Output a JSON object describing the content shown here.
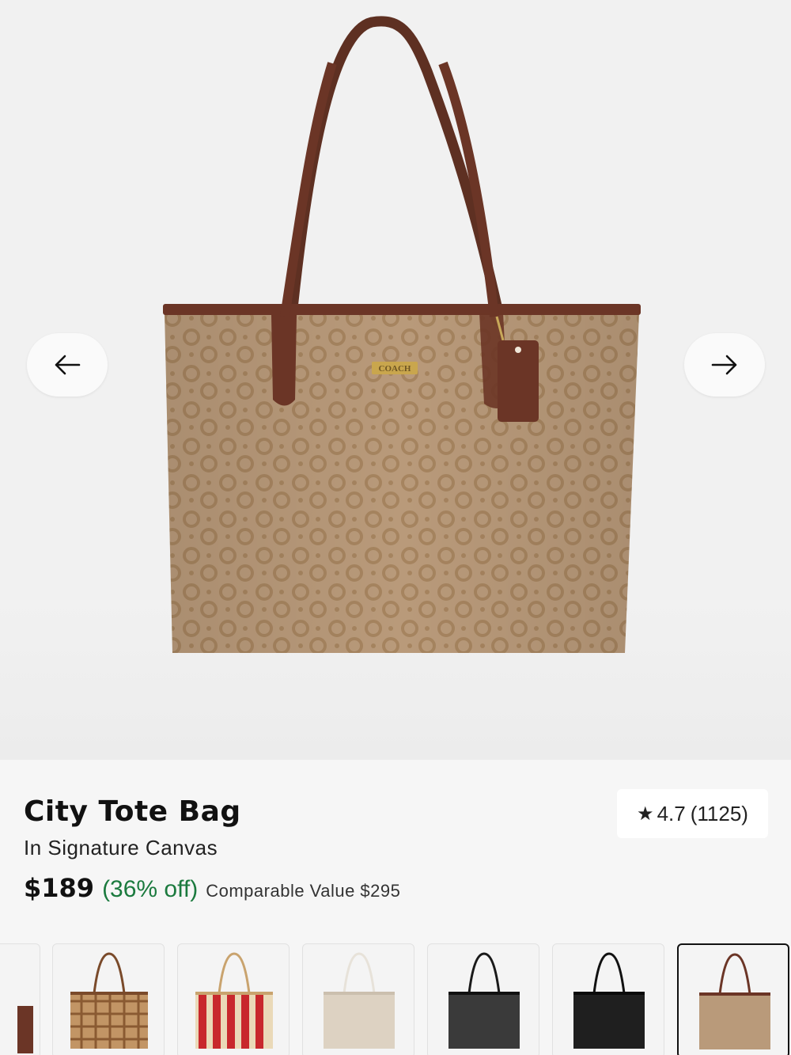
{
  "gallery": {
    "prev_label": "previous image",
    "next_label": "next image",
    "bag_logo_text": "COACH"
  },
  "product": {
    "title": "City Tote Bag",
    "subtitle": "In Signature Canvas",
    "price": "$189",
    "discount": "(36% off)",
    "comparable": "Comparable Value $295"
  },
  "rating": {
    "value": "4.7",
    "count": "(1125)"
  },
  "colors": {
    "discount_green": "#1b7a3e",
    "signature_khaki": "#b08d6c",
    "saddle_brown": "#6b3526"
  },
  "variants": [
    {
      "name": "partial",
      "selected": false
    },
    {
      "name": "plaid",
      "selected": false
    },
    {
      "name": "red-stripe",
      "selected": false
    },
    {
      "name": "light-chalk",
      "selected": false
    },
    {
      "name": "black-signature",
      "selected": false
    },
    {
      "name": "black",
      "selected": false
    },
    {
      "name": "khaki-saddle",
      "selected": true
    }
  ]
}
